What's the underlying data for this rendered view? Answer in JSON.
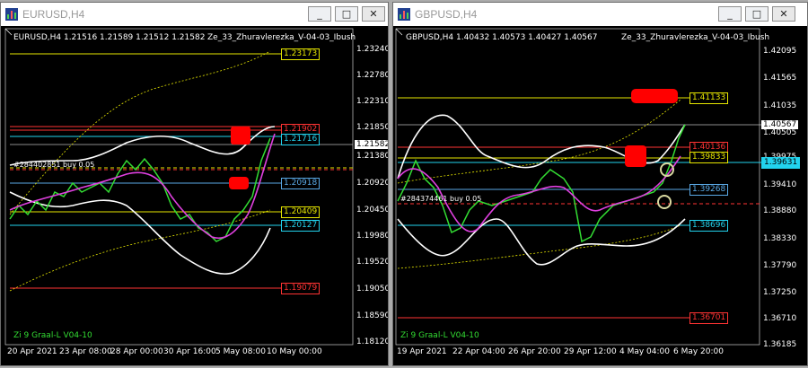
{
  "colors": {
    "bg": "#000000",
    "yellow": "#e6e600",
    "red": "#ff3333",
    "cyan": "#22d3ee",
    "blue_line": "#5aa9e6",
    "green": "#33dd33",
    "magenta": "#e040e0",
    "marker_red": "#ff0000",
    "white": "#ffffff"
  },
  "windows": [
    {
      "title": "EURUSD,H4",
      "symbol_info": "EURUSD,H4  1.21516 1.21589 1.21512 1.21582",
      "indicator_name": "Ze_33_Zhuravlerezka_V-04-03_Ibush",
      "signal_name": "Zi 9 Graal-L V04-10",
      "order_label": "#284402851 buy 0.05",
      "current_price": "1.21582",
      "price_axis": [
        "1.23240",
        "1.22780",
        "1.22310",
        "1.21850",
        "1.21380",
        "1.20920",
        "1.20450",
        "1.19980",
        "1.19520",
        "1.19050",
        "1.18590",
        "1.18120"
      ],
      "levels": [
        {
          "label": "1.23173",
          "color": "yellow"
        },
        {
          "label": "1.21902",
          "color": "red"
        },
        {
          "label": "1.21716",
          "color": "cyan"
        },
        {
          "label": "1.20918",
          "color": "blue_line"
        },
        {
          "label": "1.20409",
          "color": "yellow"
        },
        {
          "label": "1.20127",
          "color": "cyan"
        },
        {
          "label": "1.19079",
          "color": "red"
        }
      ],
      "time_axis": [
        "20 Apr 2021",
        "23 Apr 08:00",
        "28 Apr 00:00",
        "30 Apr 16:00",
        "5 May 08:00",
        "10 May 00:00"
      ]
    },
    {
      "title": "GBPUSD,H4",
      "symbol_info": "GBPUSD,H4  1.40432 1.40573 1.40427 1.40567",
      "indicator_name": "Ze_33_Zhuravlerezka_V-04-03_Ibush",
      "signal_name": "Zi 9 Graal-L V04-10",
      "order_label": "#284374461 buy 0.05",
      "current_price": "1.40567",
      "price_axis": [
        "1.42095",
        "1.41565",
        "1.41035",
        "1.40505",
        "1.39975",
        "1.39410",
        "1.38880",
        "1.38330",
        "1.37790",
        "1.37250",
        "1.36710",
        "1.36185"
      ],
      "levels": [
        {
          "label": "1.41133",
          "color": "yellow"
        },
        {
          "label": "1.40136",
          "color": "red"
        },
        {
          "label": "1.39833",
          "color": "yellow"
        },
        {
          "label": "1.39631",
          "color": "cyan"
        },
        {
          "label": "1.39268",
          "color": "blue_line"
        },
        {
          "label": "1.38696",
          "color": "cyan"
        },
        {
          "label": "1.36701",
          "color": "red"
        }
      ],
      "time_axis": [
        "19 Apr 2021",
        "22 Apr 04:00",
        "26 Apr 20:00",
        "29 Apr 12:00",
        "4 May 04:00",
        "6 May 20:00"
      ]
    }
  ],
  "buttons": {
    "minimize": "_",
    "maximize": "□",
    "close": "✕"
  }
}
